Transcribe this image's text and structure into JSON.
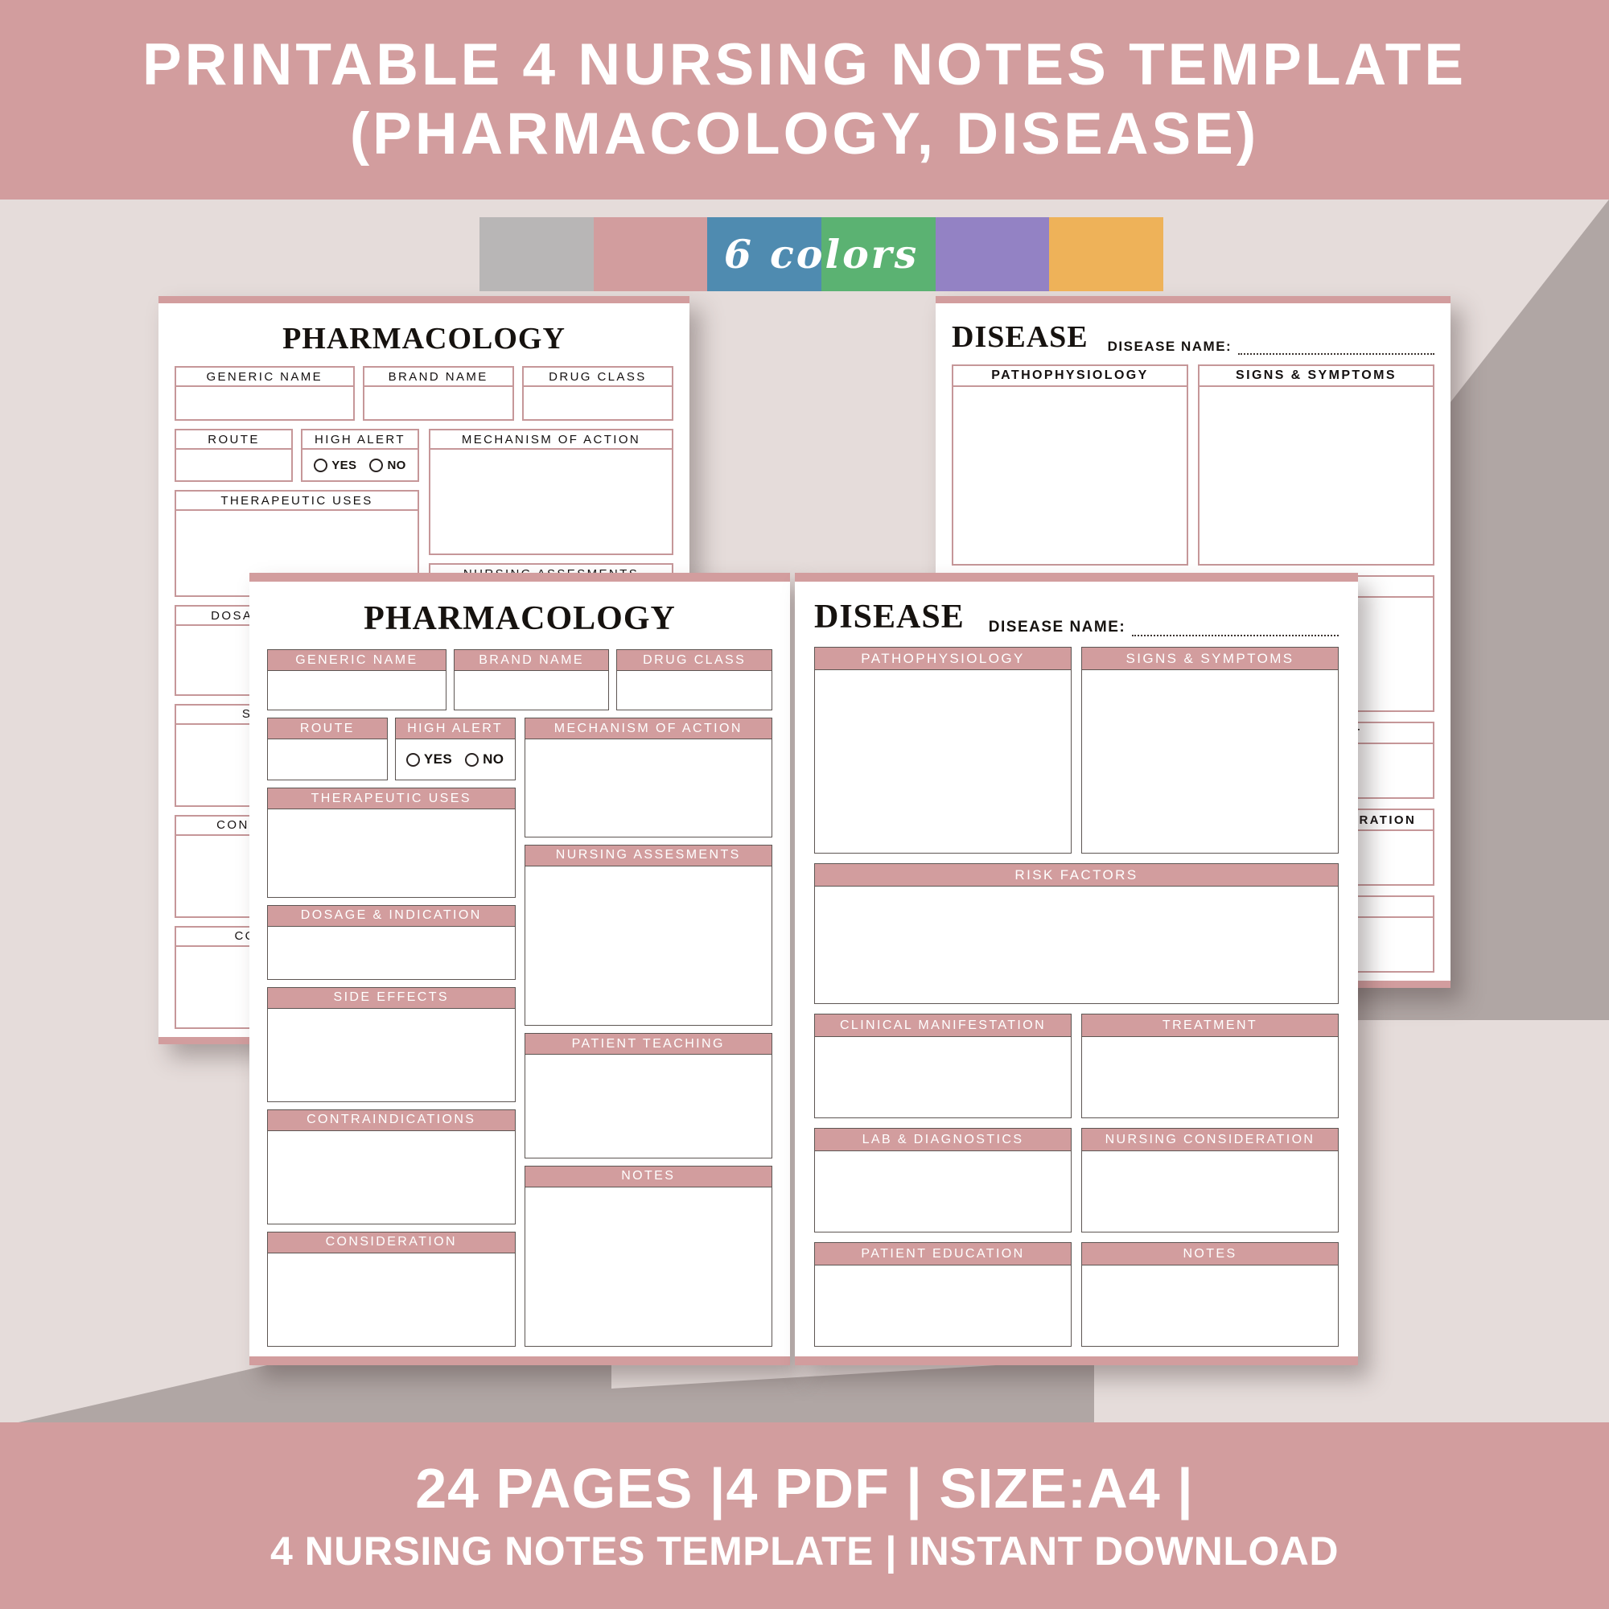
{
  "header_banner": {
    "line1": "PRINTABLE 4 NURSING NOTES TEMPLATE",
    "line2": "(PHARMACOLOGY, DISEASE)"
  },
  "footer_banner": {
    "line1": "24 PAGES |4 PDF | SIZE:A4 |",
    "line2": "4 NURSING NOTES TEMPLATE | INSTANT DOWNLOAD"
  },
  "color_strip": {
    "label": "6 colors",
    "swatches": [
      {
        "name": "gray",
        "hex": "#b8b6b6"
      },
      {
        "name": "rose",
        "hex": "#d29d9e"
      },
      {
        "name": "blue",
        "hex": "#4f8bb0"
      },
      {
        "name": "green",
        "hex": "#5bb272"
      },
      {
        "name": "purple",
        "hex": "#9382c4"
      },
      {
        "name": "orange",
        "hex": "#eeb259"
      }
    ]
  },
  "theme": {
    "accent": "#d29d9e",
    "accent_border": "#c69799",
    "page_bg": "#e5dcda",
    "shadow_band": "#b0a6a4",
    "ink": "#16120f"
  },
  "pharmacology": {
    "title": "PHARMACOLOGY",
    "fields": {
      "generic_name": "GENERIC NAME",
      "brand_name": "BRAND NAME",
      "drug_class": "DRUG CLASS",
      "route": "ROUTE",
      "high_alert": "HIGH ALERT",
      "mechanism_of_action": "MECHANISM OF ACTION",
      "therapeutic_uses": "THERAPEUTIC USES",
      "nursing_assessments": "NURSING ASSESMENTS",
      "dosage_indication": "DOSAGE & INDICATION",
      "side_effects": "SIDE EFFECTS",
      "patient_teaching": "PATIENT TEACHING",
      "contraindications": "CONTRAINDICATIONS",
      "consideration": "CONSIDERATION",
      "notes": "NOTES"
    },
    "high_alert_options": [
      "YES",
      "NO"
    ]
  },
  "disease": {
    "title": "DISEASE",
    "name_label": "DISEASE NAME:",
    "name_value": "",
    "fields": {
      "pathophysiology": "PATHOPHYSIOLOGY",
      "signs_symptoms": "SIGNS & SYMPTOMS",
      "risk_factors": "RISK FACTORS",
      "clinical_manifestation": "CLINICAL MANIFESTATION",
      "treatment": "TREATMENT",
      "lab_diagnostics": "LAB & DIAGNOSTICS",
      "nursing_consideration": "NURSING CONSIDERATION",
      "patient_education": "PATIENT EDUCATION",
      "notes": "NOTES"
    }
  }
}
